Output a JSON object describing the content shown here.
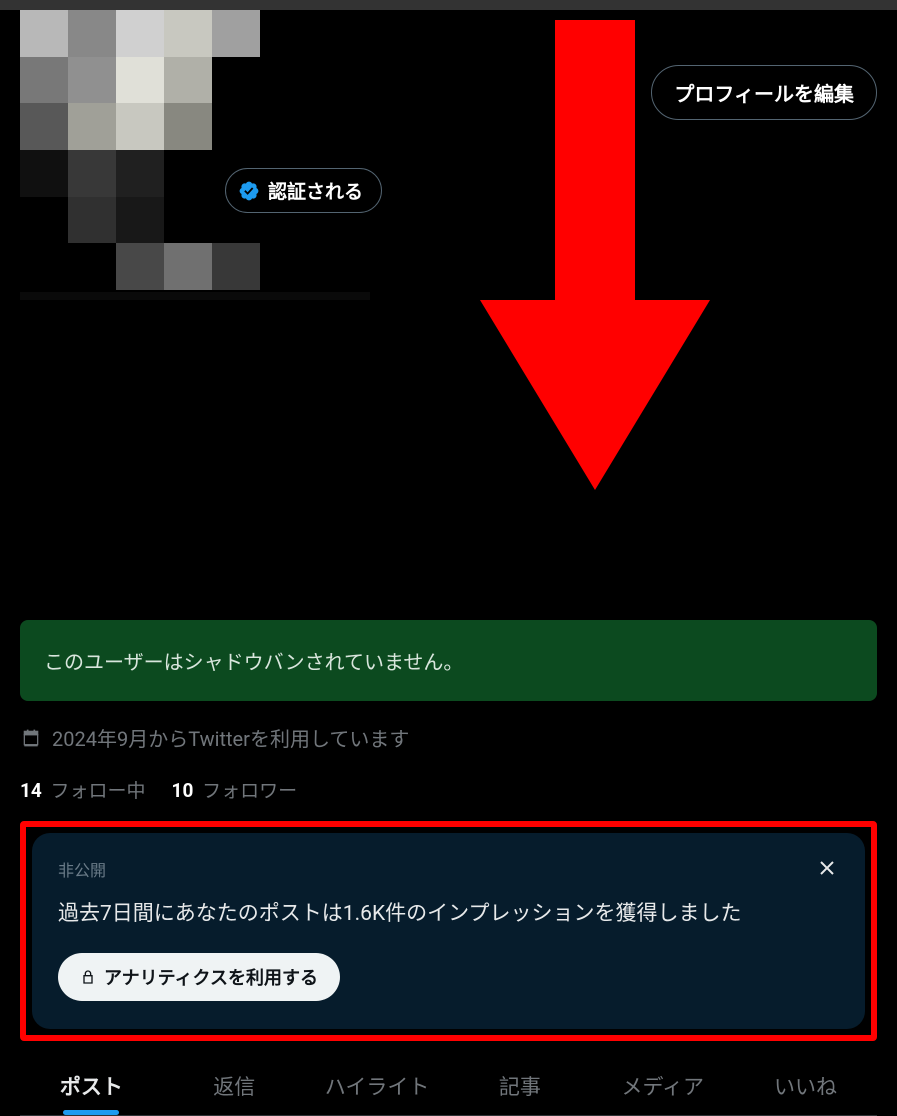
{
  "header": {
    "edit_profile_label": "プロフィールを編集",
    "verify_label": "認証される"
  },
  "shadowban": {
    "message": "このユーザーはシャドウバンされていません。"
  },
  "join_date": "2024年9月からTwitterを利用しています",
  "follow": {
    "following_count": "14",
    "following_label": "フォロー中",
    "followers_count": "10",
    "followers_label": "フォロワー"
  },
  "analytics": {
    "private_label": "非公開",
    "impressions_text": "過去7日間にあなたのポストは1.6K件のインプレッションを獲得しました",
    "button_label": "アナリティクスを利用する"
  },
  "tabs": [
    {
      "label": "ポスト",
      "active": true
    },
    {
      "label": "返信",
      "active": false
    },
    {
      "label": "ハイライト",
      "active": false
    },
    {
      "label": "記事",
      "active": false
    },
    {
      "label": "メディア",
      "active": false
    },
    {
      "label": "いいね",
      "active": false
    }
  ],
  "colors": {
    "accent": "#1d9bf0",
    "highlight_border": "#ff0000",
    "banner_bg": "#0c4a1f",
    "analytics_bg": "#061c2c"
  }
}
